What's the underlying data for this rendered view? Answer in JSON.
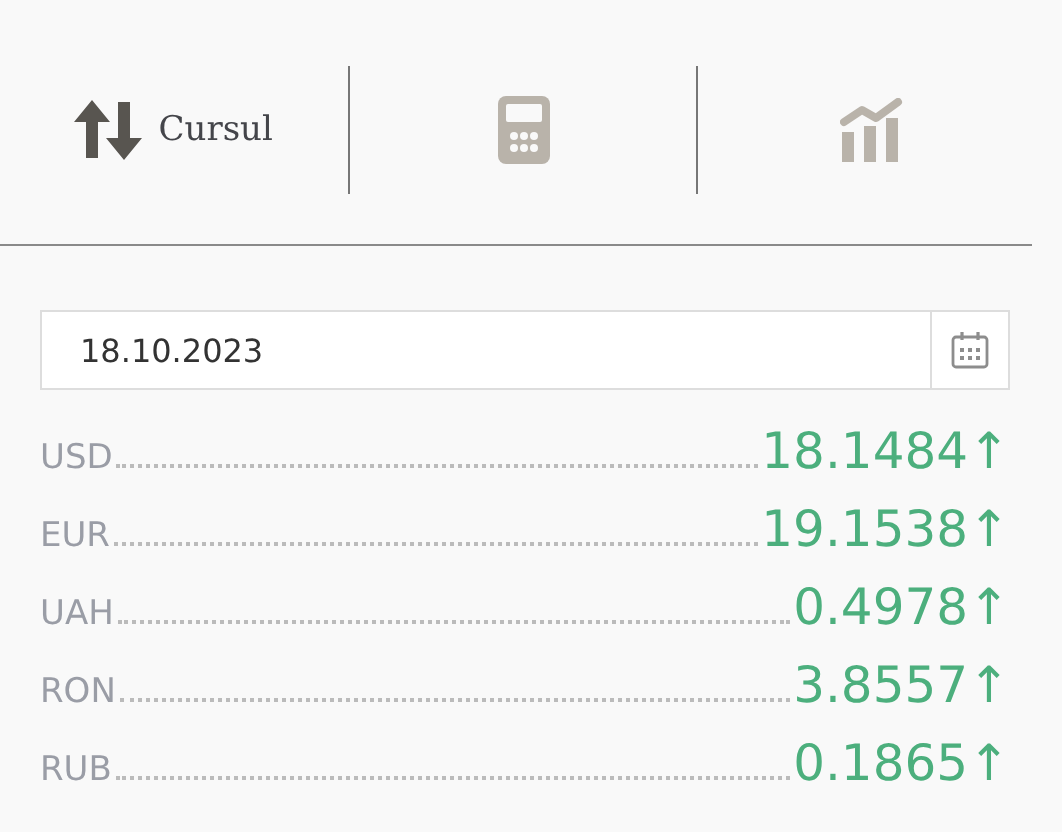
{
  "tabs": [
    {
      "kind": "rates",
      "label": "Cursul",
      "selected": true
    },
    {
      "kind": "calculator",
      "selected": false
    },
    {
      "kind": "chart",
      "selected": false
    }
  ],
  "date_field": {
    "value": "18.10.2023"
  },
  "rates": [
    {
      "code": "USD",
      "value": "18.1484",
      "trend": "↑"
    },
    {
      "code": "EUR",
      "value": "19.1538",
      "trend": "↑"
    },
    {
      "code": "UAH",
      "value": "0.4978",
      "trend": "↑"
    },
    {
      "code": "RON",
      "value": "3.8557",
      "trend": "↑"
    },
    {
      "code": "RUB",
      "value": "0.1865",
      "trend": "↑"
    }
  ]
}
